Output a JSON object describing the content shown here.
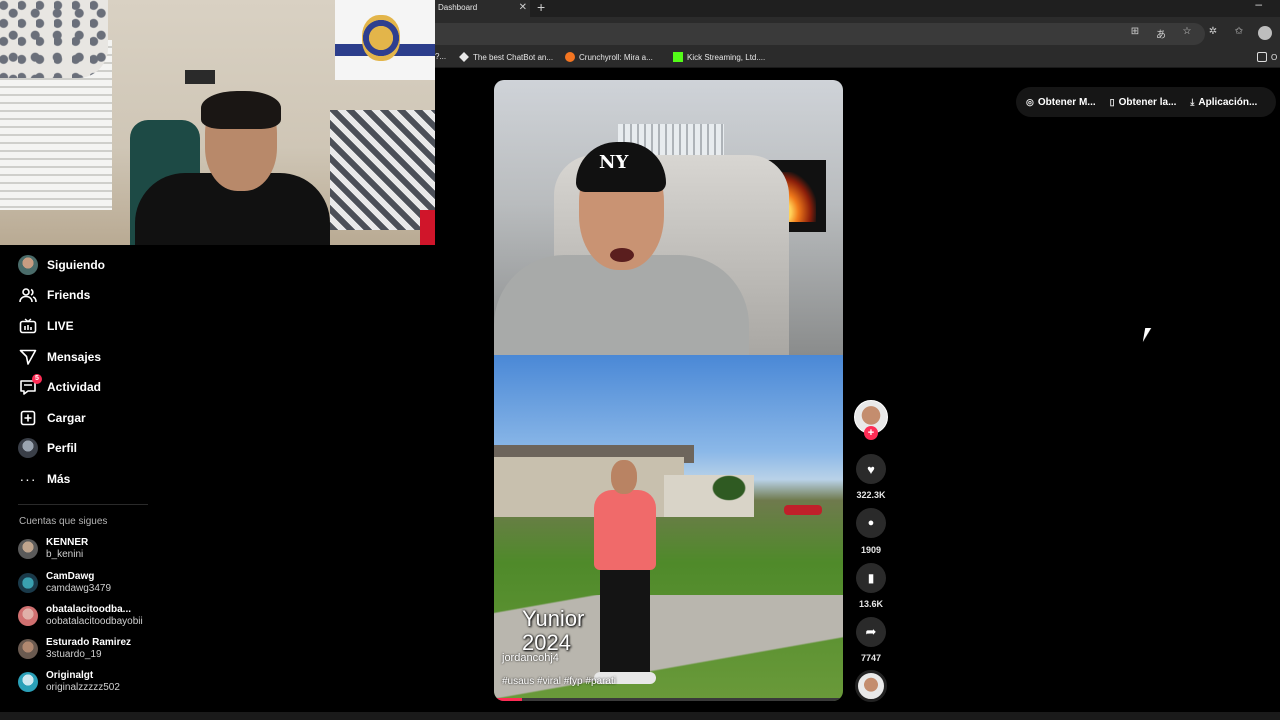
{
  "browser": {
    "tab_title": "Dashboard",
    "tab_close": "✕",
    "tab_new": "+",
    "window_minimize": "–",
    "bookmarks": [
      {
        "label": "?..."
      },
      {
        "label": "The best ChatBot an...",
        "icon": "diamond-icon"
      },
      {
        "label": "Crunchyroll: Mira a...",
        "icon": "crunchyroll-icon",
        "color": "#f47521"
      },
      {
        "label": "Kick Streaming, Ltd....",
        "icon": "kick-icon",
        "color": "#53fc18"
      },
      {
        "label": "O",
        "icon": "folder-icon"
      }
    ]
  },
  "top_actions": [
    {
      "label": "Obtener M...",
      "icon": "coin-icon"
    },
    {
      "label": "Obtener la...",
      "icon": "phone-icon"
    },
    {
      "label": "Aplicación...",
      "icon": "download-icon"
    }
  ],
  "nav": {
    "items": [
      {
        "label": "Siguiendo",
        "icon": "avatar"
      },
      {
        "label": "Friends",
        "icon": "friends-icon"
      },
      {
        "label": "LIVE",
        "icon": "live-tv-icon"
      },
      {
        "label": "Mensajes",
        "icon": "send-icon"
      },
      {
        "label": "Actividad",
        "icon": "activity-icon",
        "badge": "5"
      },
      {
        "label": "Cargar",
        "icon": "upload-plus-icon"
      },
      {
        "label": "Perfil",
        "icon": "avatar"
      },
      {
        "label": "Más",
        "icon": "more-dots-icon"
      }
    ],
    "following_title": "Cuentas que sigues",
    "accounts": [
      {
        "name": "KENNER",
        "handle": "b_kenini"
      },
      {
        "name": "CamDawg",
        "handle": "camdawg3479"
      },
      {
        "name": "obatalacitoodba...",
        "handle": "oobatalacitoodbayobii"
      },
      {
        "name": "Esturado Ramirez",
        "handle": "3stuardo_19"
      },
      {
        "name": "Originalgt",
        "handle": "originalzzzzz502"
      }
    ]
  },
  "video": {
    "overlay_title_line1": "Yunior",
    "overlay_title_line2": "2024",
    "username": "jordancohj4",
    "hashtags": "#usaus #viral #fyp #parati",
    "progress": 0.08
  },
  "actions": {
    "likes": "322.3K",
    "comments": "1909",
    "saves": "13.6K",
    "shares": "7747"
  },
  "accent_color": "#fe2c55"
}
